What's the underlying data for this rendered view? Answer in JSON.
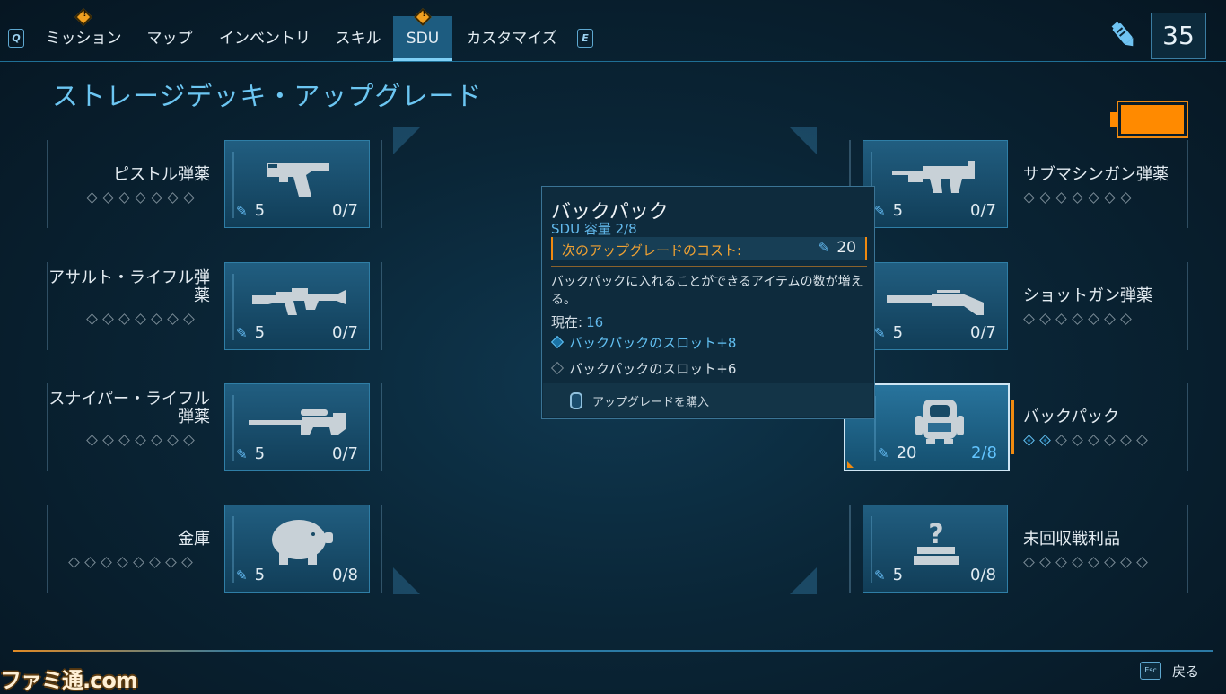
{
  "nav": {
    "left_key": "Q",
    "right_key": "E",
    "tabs": [
      {
        "label": "ミッション",
        "warning": true
      },
      {
        "label": "マップ",
        "warning": false
      },
      {
        "label": "インベントリ",
        "warning": false
      },
      {
        "label": "スキル",
        "warning": false
      },
      {
        "label": "SDU",
        "warning": true,
        "active": true
      },
      {
        "label": "カスタマイズ",
        "warning": false
      }
    ],
    "currency_icon": "pencil-cell-icon",
    "currency_value": "35"
  },
  "page_title": "ストレージデッキ・アップグレード",
  "battery": {
    "icon": "battery-icon",
    "level": 1.0,
    "color": "#ff8a00"
  },
  "left_items": [
    {
      "label": "ピストル弾薬",
      "icon": "pistol-icon",
      "cost": "5",
      "progress": "0/7",
      "pips_total": 7,
      "pips_on": 0
    },
    {
      "label": "アサルト・ライフル弾薬",
      "icon": "assault-rifle-icon",
      "cost": "5",
      "progress": "0/7",
      "pips_total": 7,
      "pips_on": 0
    },
    {
      "label": "スナイパー・ライフル弾薬",
      "icon": "sniper-rifle-icon",
      "cost": "5",
      "progress": "0/7",
      "pips_total": 7,
      "pips_on": 0
    },
    {
      "label": "金庫",
      "icon": "piggy-bank-icon",
      "cost": "5",
      "progress": "0/8",
      "pips_total": 8,
      "pips_on": 0
    }
  ],
  "right_items": [
    {
      "label": "サブマシンガン弾薬",
      "icon": "smg-icon",
      "cost": "5",
      "progress": "0/7",
      "pips_total": 7,
      "pips_on": 0
    },
    {
      "label": "ショットガン弾薬",
      "icon": "shotgun-icon",
      "cost": "5",
      "progress": "0/7",
      "pips_total": 7,
      "pips_on": 0
    },
    {
      "label": "バックパック",
      "icon": "backpack-icon",
      "cost": "20",
      "progress": "2/8",
      "pips_total": 8,
      "pips_on": 2,
      "selected": true
    },
    {
      "label": "未回収戦利品",
      "icon": "unclaimed-loot-icon",
      "cost": "5",
      "progress": "0/8",
      "pips_total": 8,
      "pips_on": 0
    }
  ],
  "tooltip": {
    "title": "バックパック",
    "capacity": "SDU 容量 2/8",
    "cost_label": "次のアップグレードのコスト:",
    "cost_value": "20",
    "description": "バックパックに入れることができるアイテムの数が増える。",
    "current_label": "現在:",
    "current_value": "16",
    "next_line": "バックパックのスロット+8",
    "prev_line": "バックパックのスロット+6",
    "action_label": "アップグレードを購入"
  },
  "footer": {
    "esc_key": "Esc",
    "back_label": "戻る",
    "watermark": "ファミ通.com"
  }
}
